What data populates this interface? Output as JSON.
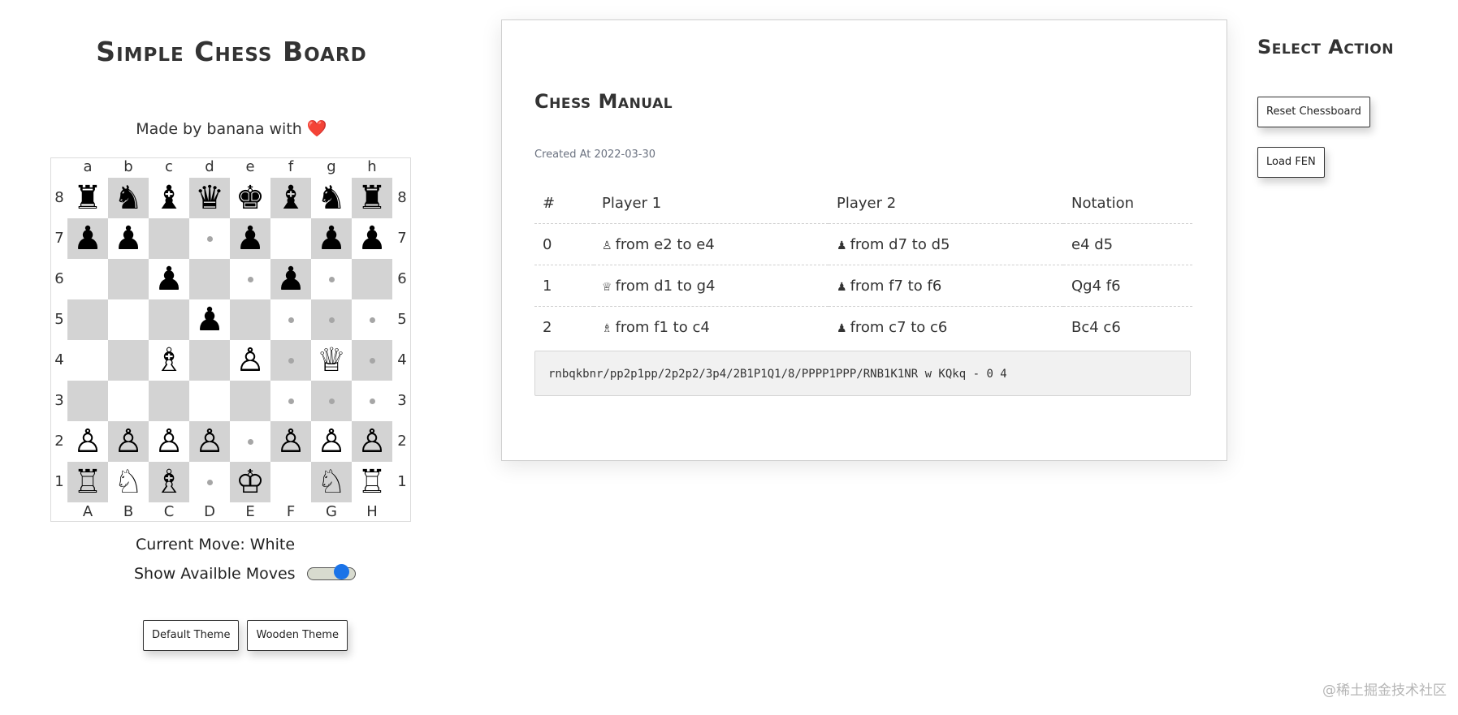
{
  "header": {
    "title": "Simple Chess Board",
    "credit_prefix": "Made by banana with",
    "heart_icon": "❤️"
  },
  "board": {
    "files_top": [
      "a",
      "b",
      "c",
      "d",
      "e",
      "f",
      "g",
      "h"
    ],
    "files_bottom": [
      "A",
      "B",
      "C",
      "D",
      "E",
      "F",
      "G",
      "H"
    ],
    "ranks": [
      "8",
      "7",
      "6",
      "5",
      "4",
      "3",
      "2",
      "1"
    ],
    "light_color": "#ffffff",
    "dark_color": "#d3d3d3",
    "rows": [
      [
        "br",
        "bn",
        "bb",
        "bq",
        "bk",
        "bb",
        "bn",
        "br"
      ],
      [
        "bp",
        "bp",
        "",
        "*",
        "bp",
        "",
        "bp",
        "bp"
      ],
      [
        "",
        "",
        "bp",
        "",
        "*",
        "bp",
        "*",
        ""
      ],
      [
        "",
        "",
        "",
        "bp",
        "",
        "*",
        "*",
        "*"
      ],
      [
        "",
        "",
        "wb",
        "",
        "wp",
        "*",
        "wq",
        "*"
      ],
      [
        "",
        "",
        "",
        "",
        "",
        "*",
        "*",
        "*"
      ],
      [
        "wp",
        "wp",
        "wp",
        "wp",
        "*",
        "wp",
        "wp",
        "wp"
      ],
      [
        "wr",
        "wn",
        "wb",
        "*",
        "wk",
        "",
        "wn",
        "wr"
      ]
    ]
  },
  "status": {
    "current_move": "Current Move: White",
    "show_moves_label": "Show Availble Moves",
    "show_moves_enabled": true
  },
  "themes": {
    "default_label": "Default Theme",
    "wooden_label": "Wooden Theme"
  },
  "manual": {
    "title": "Chess Manual",
    "created": "Created At 2022-03-30",
    "headers": [
      "#",
      "Player 1",
      "Player 2",
      "Notation"
    ],
    "rows": [
      {
        "num": "0",
        "p1_icon": "♙",
        "p1": "from e2 to e4",
        "p2_icon": "♟",
        "p2": "from d7 to d5",
        "notation": "e4 d5"
      },
      {
        "num": "1",
        "p1_icon": "♕",
        "p1": "from d1 to g4",
        "p2_icon": "♟",
        "p2": "from f7 to f6",
        "notation": "Qg4 f6"
      },
      {
        "num": "2",
        "p1_icon": "♗",
        "p1": "from f1 to c4",
        "p2_icon": "♟",
        "p2": "from c7 to c6",
        "notation": "Bc4 c6"
      }
    ],
    "fen": "rnbqkbnr/pp2p1pp/2p2p2/3p4/2B1P1Q1/8/PPPP1PPP/RNB1K1NR w KQkq - 0 4"
  },
  "actions": {
    "title": "Select Action",
    "reset_label": "Reset Chessboard",
    "load_fen_label": "Load FEN"
  },
  "watermark": "@稀土掘金技术社区"
}
